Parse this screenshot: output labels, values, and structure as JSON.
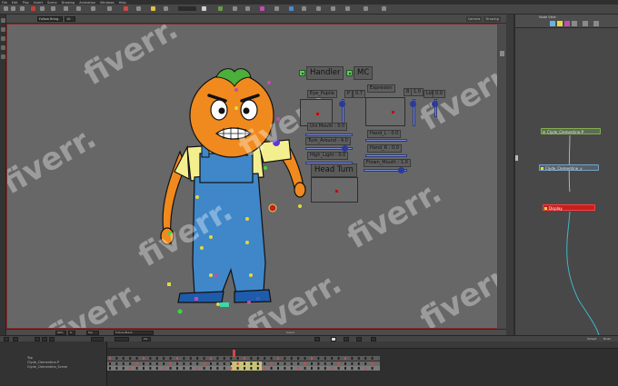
{
  "menu": {
    "items": [
      "File",
      "Edit",
      "Play",
      "Insert",
      "Scene",
      "Drawing",
      "Animation",
      "Windows",
      "Help"
    ]
  },
  "viewport": {
    "view_field": "Follow Bring",
    "zoom_field": "10",
    "tabs": [
      "Camera",
      "Drawing"
    ],
    "footer_fields": [
      "96%",
      "0",
      "Top",
      "Follow Blank"
    ],
    "scene_label": "Scene"
  },
  "rig": {
    "handler_label": "Handler",
    "mc_label": "MC",
    "eye_pupile_label": "Eye_Pupile",
    "p_label": "P",
    "p_value": "0.7",
    "expresion_label": "Expresion",
    "b_label": "B",
    "b_value": "1.0",
    "lid_label": "Lid",
    "lid_value": "0.0",
    "uni_mouth_label": "Uni Mouth : 0.0",
    "turn_around_label": "Turn_Around : 4.0",
    "high_light_label": "High_Light : 0.0",
    "hand_l_label": "Hand_L : 0.0",
    "hand_r_label": "Hand_R : 0.0",
    "frown_mouth_label": "Frown_Mouth : 1.0",
    "head_turn_label": "Head Turn"
  },
  "node_view": {
    "title": "Node View",
    "nodes": [
      {
        "label": "Clyde_Clementine-P",
        "color": "#7fb04d"
      },
      {
        "label": "Clyde_Clementine_v",
        "color": "#73a4c8"
      },
      {
        "label": "Display",
        "color": "#c81e1e"
      }
    ],
    "footer_tabs": [
      "Xsheet",
      "Node"
    ]
  },
  "timeline": {
    "layers": [
      "Top",
      "Clyde_Clementine-P",
      "Clyde_Clementine_Scene"
    ],
    "frame_count": "24"
  },
  "watermark_text": "fiverr.",
  "colors": {
    "viewport_bg": "#676767",
    "character_orange": "#f08a1e",
    "shirt_yellow": "#f4ef8e",
    "overalls_blue": "#3f87c9",
    "accent_red": "#c81e1e"
  }
}
